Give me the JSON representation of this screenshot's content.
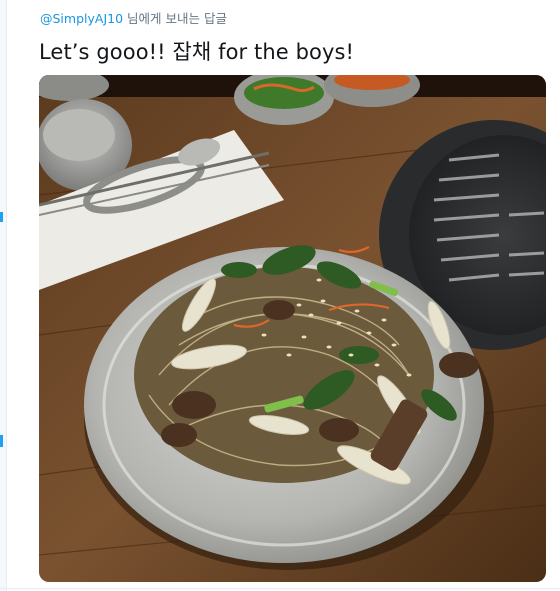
{
  "reply_context": {
    "handle": "@SimplyAJ10",
    "suffix": "님에게 보내는 답글"
  },
  "tweet": {
    "text": "Let’s gooo!! 잡채 for the boys!"
  },
  "media": {
    "subject": "photo"
  },
  "colors": {
    "link": "#1b95e0",
    "text": "#14171a",
    "muted": "#657786"
  }
}
